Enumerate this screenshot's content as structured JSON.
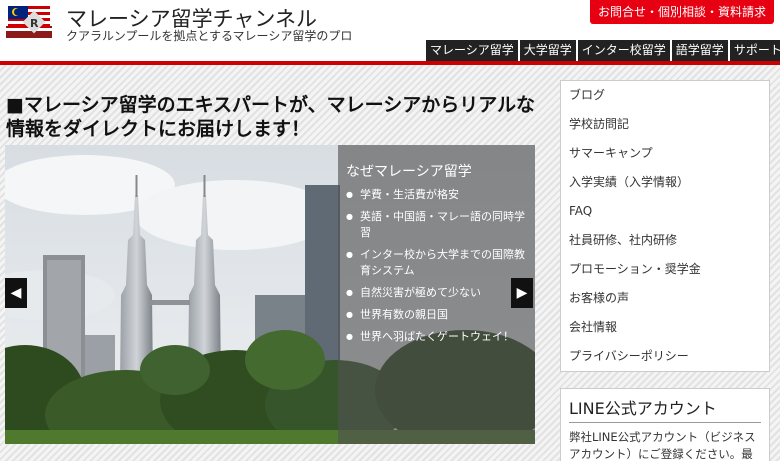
{
  "header": {
    "site_title": "マレーシア留学チャンネル",
    "site_subtitle": "クアラルンプールを拠点とするマレーシア留学のプロ",
    "contact_button": "お問合せ・個別相談・資料請求",
    "logo_icon": "book-malaysia-flag-logo"
  },
  "nav": {
    "items": [
      "マレーシア留学",
      "大学留学",
      "インター校留学",
      "語学留学",
      "サポート"
    ]
  },
  "main": {
    "title": "■マレーシア留学のエキスパートが、マレーシアからリアルな情報をダイレクトにお届けします！"
  },
  "slider": {
    "caption_title": "なぜマレーシア留学",
    "points": [
      "学費・生活費が格安",
      "英語・中国語・マレー語の同時学習",
      "インター校から大学までの国際教育システム",
      "自然災害が極めて少ない",
      "世界有数の親日国",
      "世界へ羽ばたくゲートウェイ！"
    ],
    "prev_arrow": "◀",
    "next_arrow": "▶"
  },
  "sidebar": {
    "items": [
      "ブログ",
      "学校訪問記",
      "サマーキャンプ",
      "入学実績（入学情報）",
      "FAQ",
      "社員研修、社内研修",
      "プロモーション・奨学金",
      "お客様の声",
      "会社情報",
      "プライバシーポリシー"
    ]
  },
  "line_box": {
    "title": "LINE公式アカウント",
    "text": "弊社LINE公式アカウント（ビジネスアカウント）にご登録ください。最"
  },
  "colors": {
    "accent_red": "#e60012",
    "nav_bg": "#222222"
  }
}
